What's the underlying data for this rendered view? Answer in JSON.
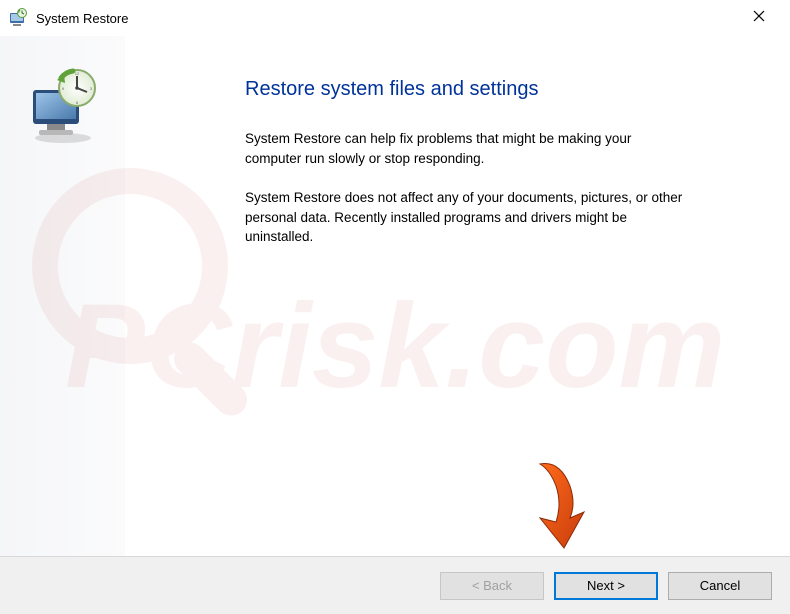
{
  "window": {
    "title": "System Restore"
  },
  "content": {
    "heading": "Restore system files and settings",
    "paragraph1": "System Restore can help fix problems that might be making your computer run slowly or stop responding.",
    "paragraph2": "System Restore does not affect any of your documents, pictures, or other personal data. Recently installed programs and drivers might be uninstalled."
  },
  "buttons": {
    "back": "< Back",
    "next": "Next >",
    "cancel": "Cancel"
  }
}
